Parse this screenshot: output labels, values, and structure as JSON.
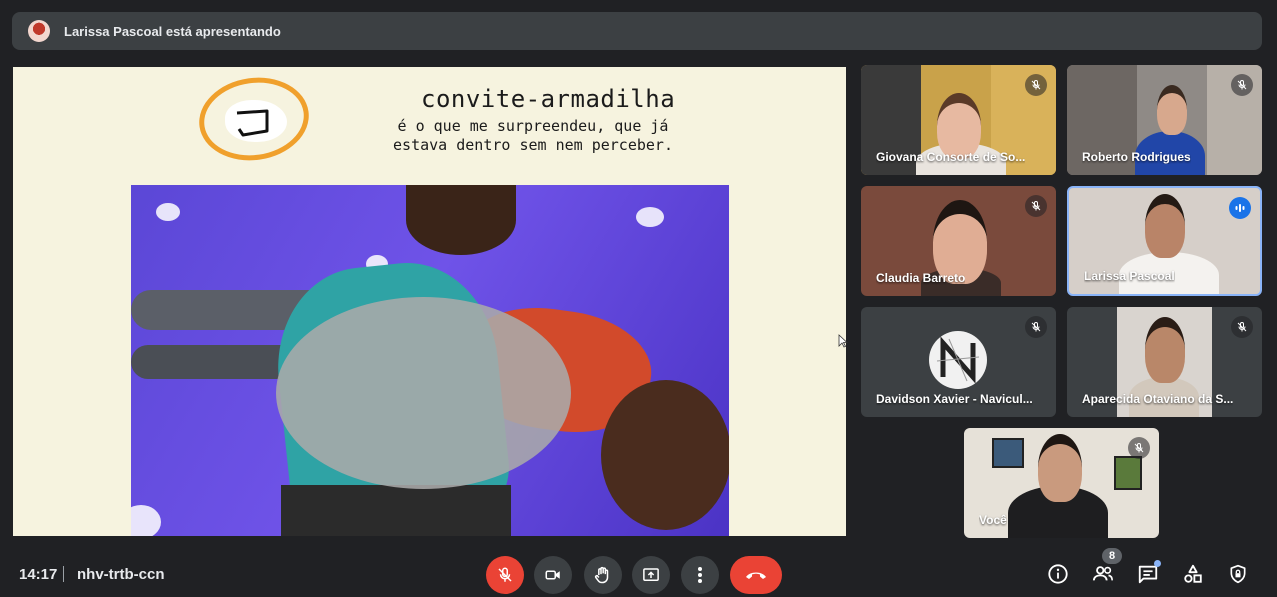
{
  "banner": {
    "text": "Larissa Pascoal está apresentando"
  },
  "slide": {
    "title": "convite-armadilha",
    "subtitle_line1": "é o que me surpreendeu, que já",
    "subtitle_line2": "estava dentro sem nem perceber."
  },
  "participants": [
    {
      "name": "Giovana Consorte de So...",
      "muted": true
    },
    {
      "name": "Roberto Rodrigues",
      "muted": true
    },
    {
      "name": "Claudia Barreto",
      "muted": true
    },
    {
      "name": "Larissa Pascoal",
      "muted": false,
      "speaking": true
    },
    {
      "name": "Davidson Xavier - Navicul...",
      "muted": true
    },
    {
      "name": "Aparecida Otaviano da S...",
      "muted": true
    },
    {
      "name": "Você",
      "muted": true
    }
  ],
  "footer": {
    "time": "14:17",
    "meeting_code": "nhv-trtb-ccn",
    "people_count": "8"
  },
  "colors": {
    "accent_blue": "#1a73e8",
    "end_call_red": "#ea4335",
    "logo_orange": "#f0a02c"
  },
  "icons": {
    "mic_off": "mic-off-icon",
    "camera": "camera-icon",
    "hand": "raise-hand-icon",
    "present": "present-icon",
    "more": "more-vert-icon",
    "hangup": "hangup-icon",
    "info": "info-icon",
    "people": "people-icon",
    "chat": "chat-icon",
    "activities": "activities-icon",
    "host": "host-controls-icon"
  }
}
